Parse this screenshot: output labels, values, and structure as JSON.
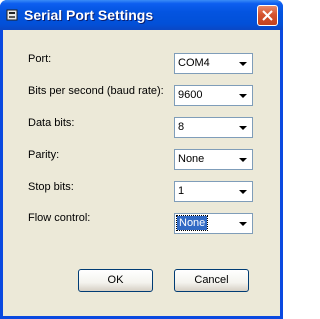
{
  "window": {
    "title": "Serial Port Settings",
    "accent_color": "#0a49e0",
    "close_color": "#d5532f"
  },
  "fields": {
    "port": {
      "label": "Port:",
      "value": "COM4"
    },
    "baud": {
      "label": "Bits per second (baud rate):",
      "value": "9600"
    },
    "data_bits": {
      "label": "Data bits:",
      "value": "8"
    },
    "parity": {
      "label": "Parity:",
      "value": "None"
    },
    "stop_bits": {
      "label": "Stop bits:",
      "value": "1"
    },
    "flow_control": {
      "label": "Flow control:",
      "value": "None"
    }
  },
  "buttons": {
    "ok": "OK",
    "cancel": "Cancel"
  }
}
